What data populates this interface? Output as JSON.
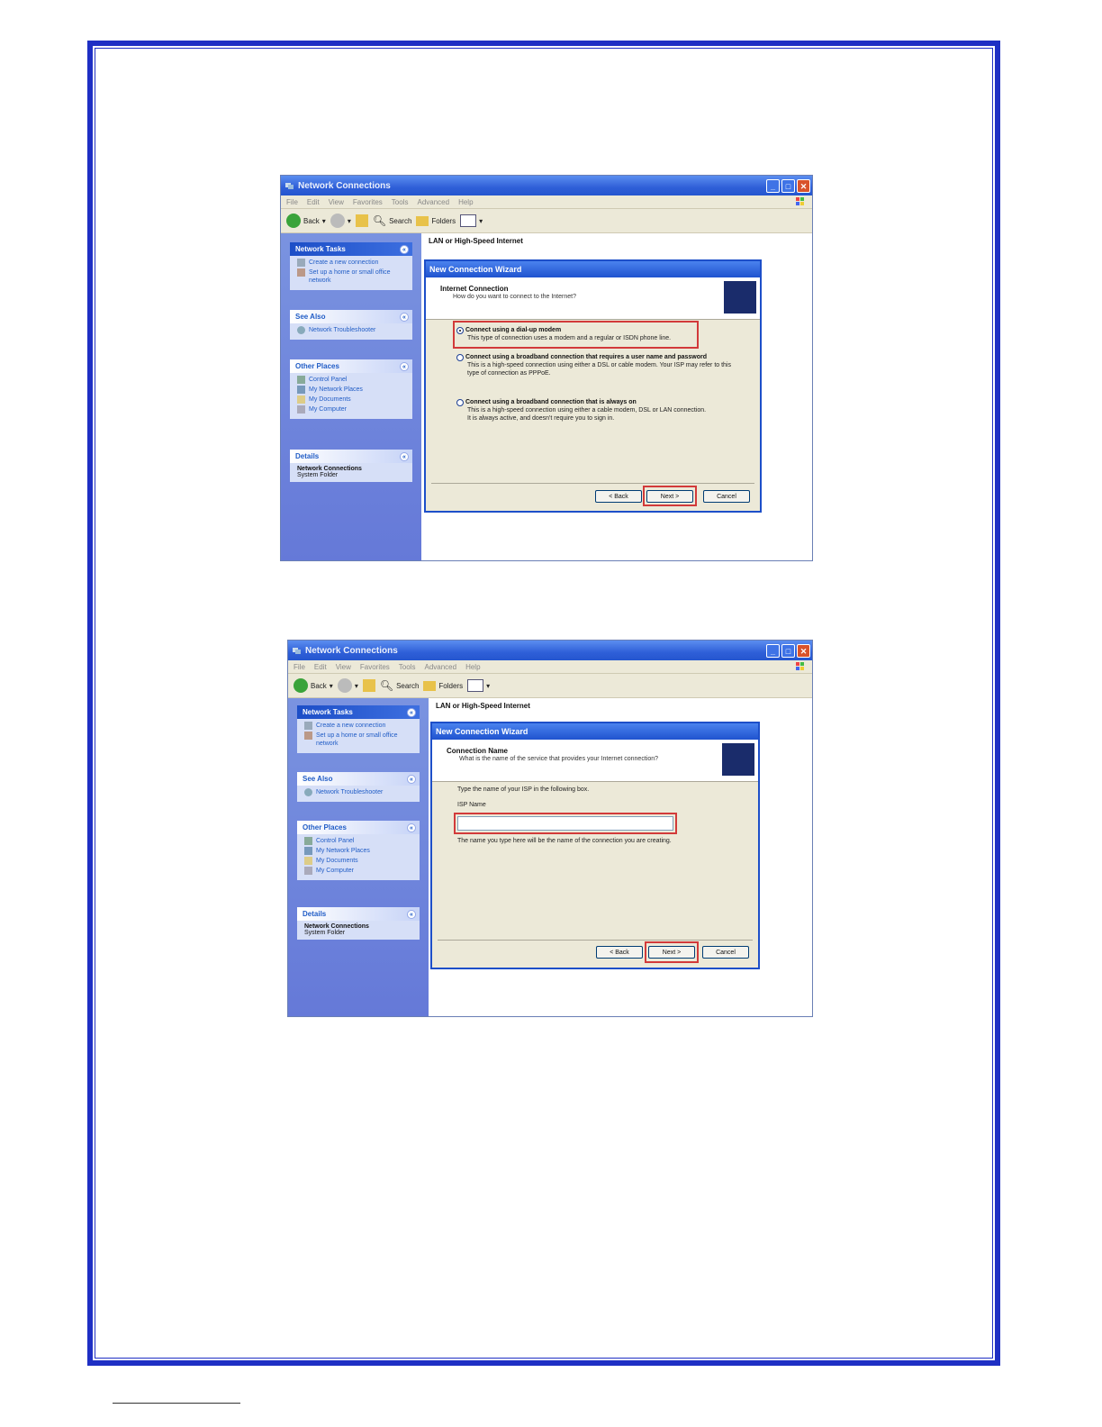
{
  "screenshot1": {
    "window_title": "Network Connections",
    "menu": [
      "File",
      "Edit",
      "View",
      "Favorites",
      "Tools",
      "Advanced",
      "Help"
    ],
    "toolbar": {
      "back": "Back",
      "search": "Search",
      "folders": "Folders"
    },
    "heading": "LAN or High-Speed Internet",
    "network_tasks": {
      "title": "Network Tasks",
      "items": [
        "Create a new connection",
        "Set up a home or small office network"
      ]
    },
    "see_also": {
      "title": "See Also",
      "items": [
        "Network Troubleshooter"
      ]
    },
    "other_places": {
      "title": "Other Places",
      "items": [
        "Control Panel",
        "My Network Places",
        "My Documents",
        "My Computer"
      ]
    },
    "details": {
      "title": "Details",
      "name": "Network Connections",
      "type": "System Folder"
    },
    "wizard": {
      "title": "New Connection Wizard",
      "header_title": "Internet Connection",
      "header_sub": "How do you want to connect to the Internet?",
      "options": [
        {
          "title": "Connect using a dial-up modem",
          "desc": "This type of connection uses a modem and a regular or ISDN phone line."
        },
        {
          "title": "Connect using a broadband connection that requires a user name and password",
          "desc": "This is a high-speed connection using either a DSL or cable modem. Your ISP may refer to this type of connection as PPPoE."
        },
        {
          "title": "Connect using a broadband connection that is always on",
          "desc": "This is a high-speed connection using either a cable modem, DSL or LAN connection. It is always active, and doesn't require you to sign in."
        }
      ],
      "back": "< Back",
      "next": "Next >",
      "cancel": "Cancel"
    }
  },
  "screenshot2": {
    "window_title": "Network Connections",
    "menu": [
      "File",
      "Edit",
      "View",
      "Favorites",
      "Tools",
      "Advanced",
      "Help"
    ],
    "toolbar": {
      "back": "Back",
      "search": "Search",
      "folders": "Folders"
    },
    "heading": "LAN or High-Speed Internet",
    "network_tasks": {
      "title": "Network Tasks",
      "items": [
        "Create a new connection",
        "Set up a home or small office network"
      ]
    },
    "see_also": {
      "title": "See Also",
      "items": [
        "Network Troubleshooter"
      ]
    },
    "other_places": {
      "title": "Other Places",
      "items": [
        "Control Panel",
        "My Network Places",
        "My Documents",
        "My Computer"
      ]
    },
    "details": {
      "title": "Details",
      "name": "Network Connections",
      "type": "System Folder"
    },
    "wizard": {
      "title": "New Connection Wizard",
      "header_title": "Connection Name",
      "header_sub": "What is the name of the service that provides your Internet connection?",
      "instruction": "Type the name of your ISP in the following box.",
      "isp_label": "ISP Name",
      "isp_value": "",
      "note": "The name you type here will be the name of the connection you are creating.",
      "back": "< Back",
      "next": "Next >",
      "cancel": "Cancel"
    }
  },
  "colors": {
    "frame": "#1e2fc4",
    "highlight": "#d23a3a",
    "xp_blue": "#2456cf"
  }
}
